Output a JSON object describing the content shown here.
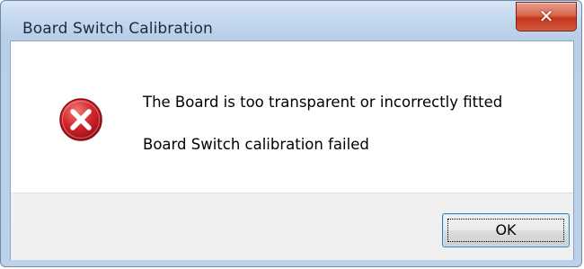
{
  "window": {
    "title": "Board Switch Calibration",
    "close_icon": "close-icon"
  },
  "message": {
    "icon": "error-icon",
    "line1": "The Board is too transparent or incorrectly fitted",
    "line2": "Board Switch calibration failed"
  },
  "buttons": {
    "ok_label": "OK"
  },
  "colors": {
    "error_red": "#c4161c",
    "close_red": "#c5371d",
    "title_blue": "#c6d9ee",
    "button_area_gray": "#f0f0f0"
  }
}
